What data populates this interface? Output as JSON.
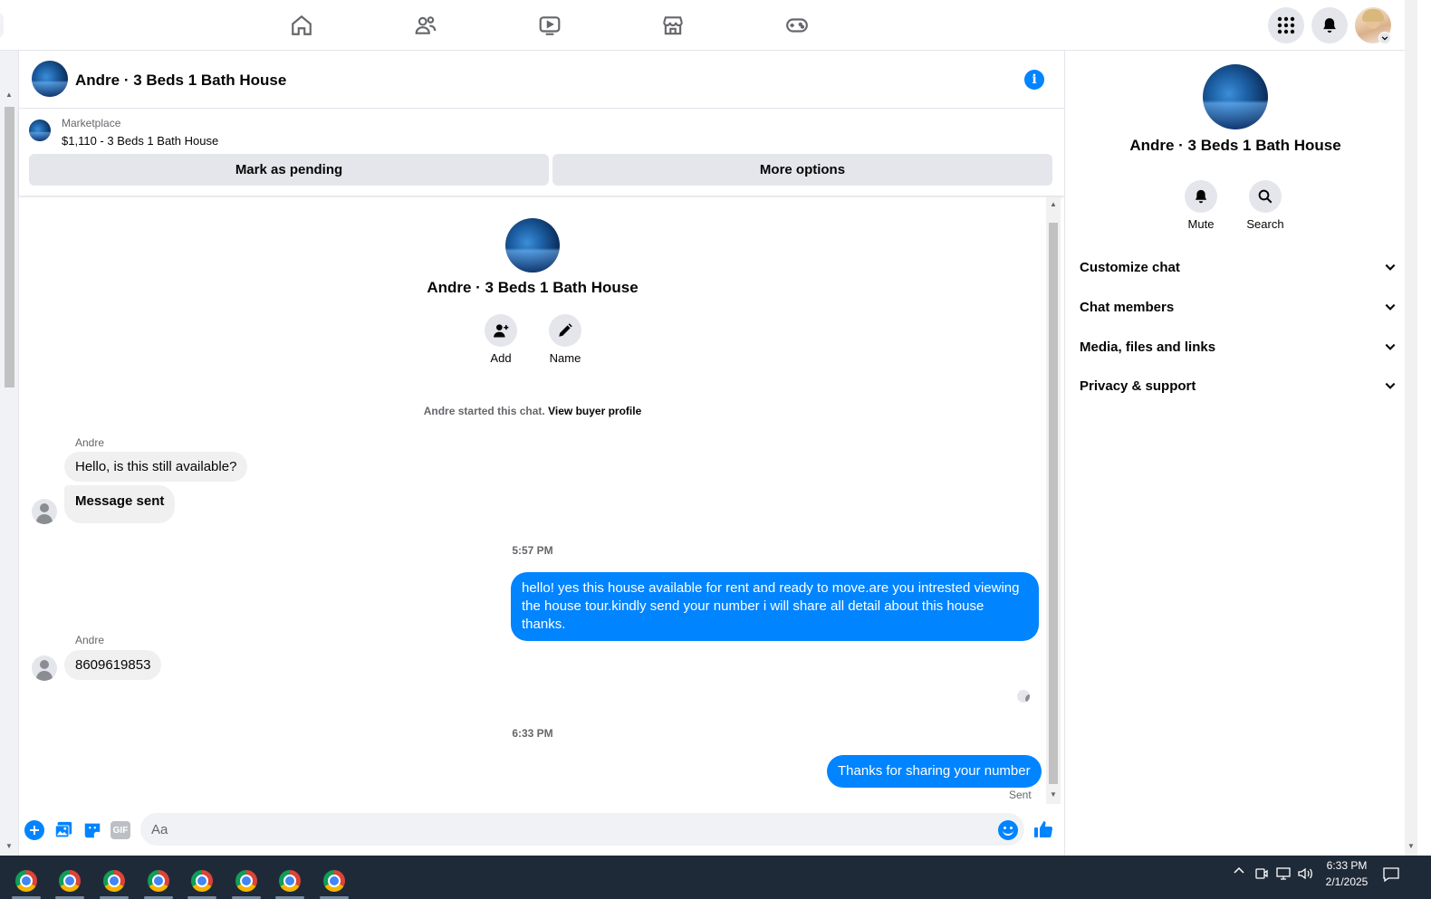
{
  "chat": {
    "title": "Andre · 3 Beds 1 Bath House"
  },
  "listing": {
    "category": "Marketplace",
    "summary": "$1,110 - 3 Beds 1 Bath House",
    "mark_pending_label": "Mark as pending",
    "more_options_label": "More options"
  },
  "intro": {
    "title": "Andre · 3 Beds 1 Bath House",
    "add_label": "Add",
    "name_label": "Name",
    "started_text": "Andre started this chat.",
    "view_profile_link": "View buyer profile"
  },
  "messages": {
    "sender1": "Andre",
    "msg1": "Hello, is this still available?",
    "msg2": "Message sent",
    "time1": "5:57 PM",
    "out1": "hello! yes this house available for rent and ready to move.are you intrested viewing the house tour.kindly send your number i will share all detail about this house thanks.",
    "sender2": "Andre",
    "msg3": "8609619853",
    "time2": "6:33 PM",
    "out2": "Thanks for sharing your number",
    "status": "Sent"
  },
  "composer": {
    "placeholder": "Aa",
    "gif_label": "GIF"
  },
  "panel": {
    "title": "Andre · 3 Beds 1 Bath House",
    "mute_label": "Mute",
    "search_label": "Search",
    "sections": [
      "Customize chat",
      "Chat members",
      "Media, files and links",
      "Privacy & support"
    ]
  },
  "taskbar": {
    "time": "6:33 PM",
    "date": "2/1/2025"
  },
  "colors": {
    "accent": "#0084ff",
    "taskbar": "#1f2a38"
  }
}
